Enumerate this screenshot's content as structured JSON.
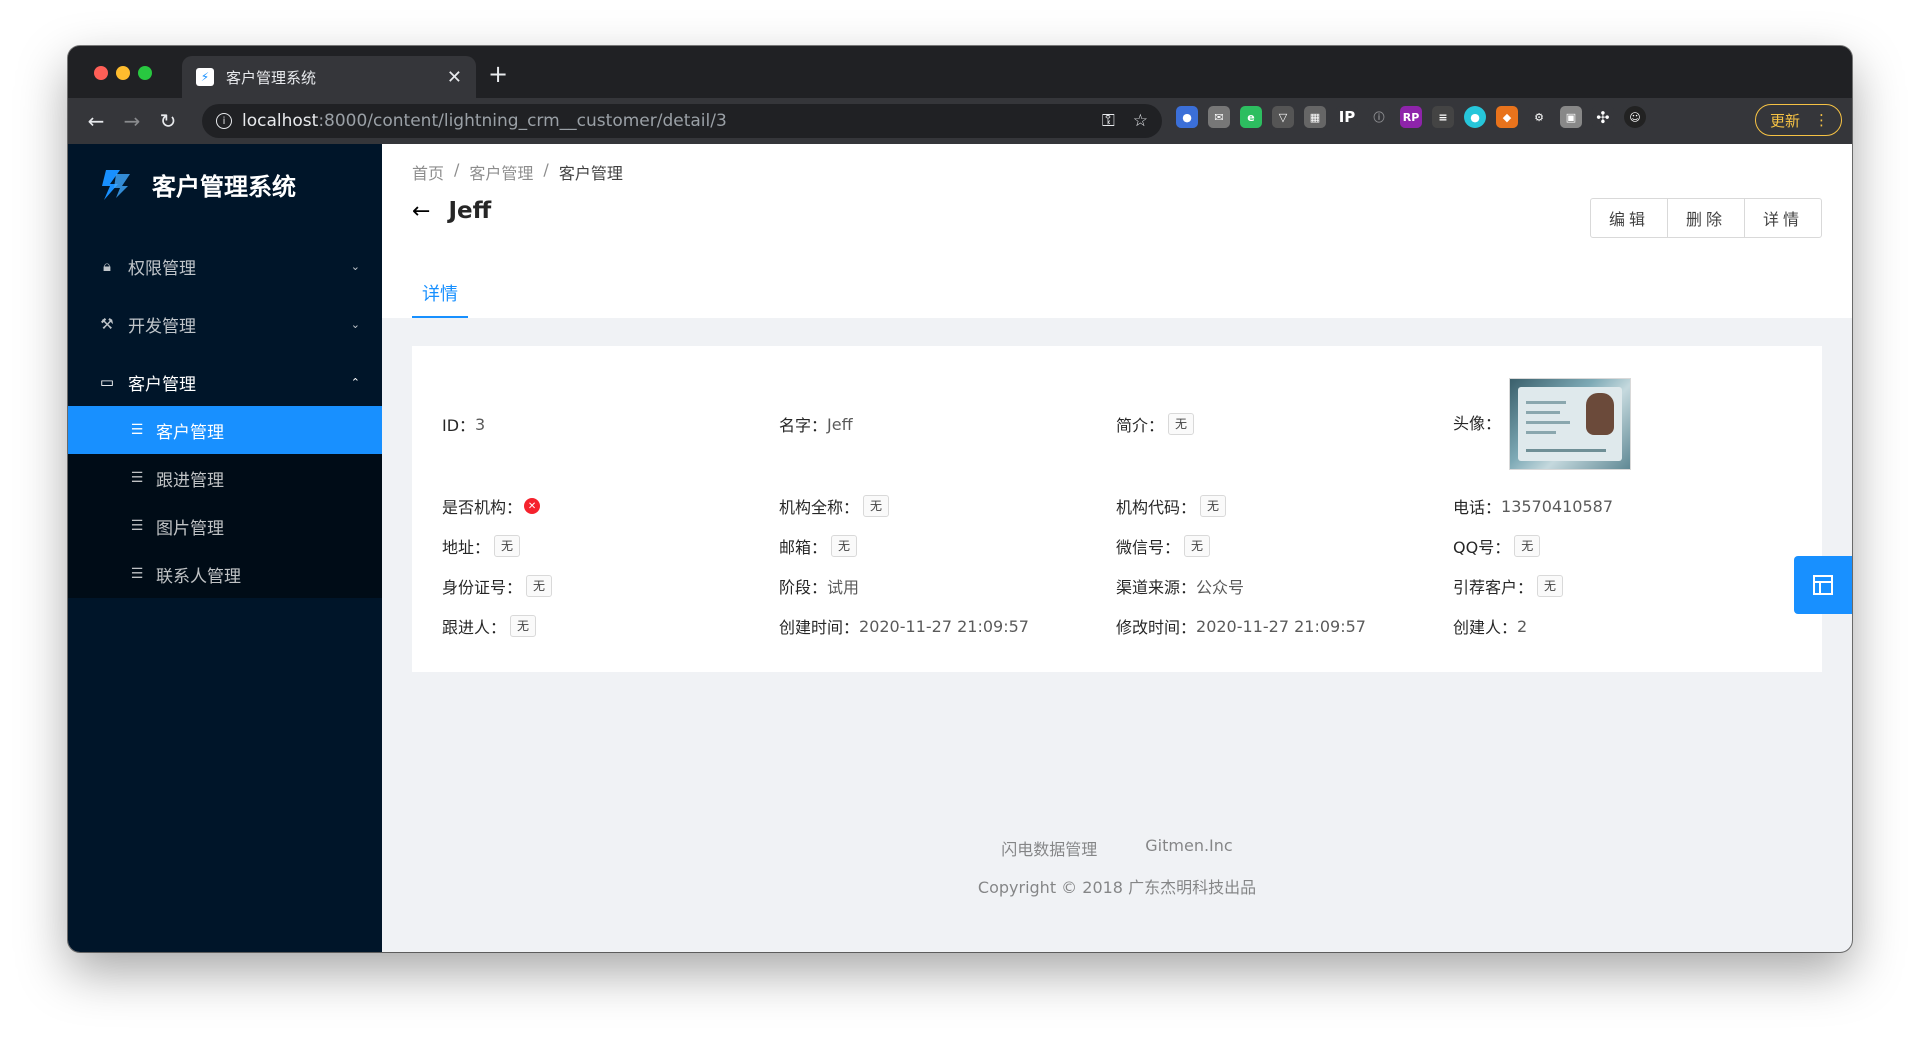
{
  "browser": {
    "tab_title": "客户管理系统",
    "url_host": "localhost",
    "url_rest": ":8000/content/lightning_crm__customer/detail/3",
    "update_label": "更新"
  },
  "sider": {
    "app_name": "客户管理系统",
    "menu": [
      {
        "label": "权限管理",
        "icon": "lock-icon"
      },
      {
        "label": "开发管理",
        "icon": "tool-icon"
      },
      {
        "label": "客户管理",
        "icon": "idcard-icon"
      }
    ],
    "submenu": [
      {
        "label": "客户管理"
      },
      {
        "label": "跟进管理"
      },
      {
        "label": "图片管理"
      },
      {
        "label": "联系人管理"
      }
    ]
  },
  "header": {
    "breadcrumb": [
      "首页",
      "/",
      "客户管理",
      "/",
      "客户管理"
    ],
    "title": "Jeff",
    "buttons": [
      "编辑",
      "删除",
      "详情"
    ],
    "tab": "详情"
  },
  "details": {
    "row1": [
      {
        "label": "ID：",
        "value": "3"
      },
      {
        "label": "名字：",
        "value": "Jeff"
      },
      {
        "label": "简介：",
        "tag": "无"
      },
      {
        "label": "头像："
      }
    ],
    "row2": [
      {
        "label": "是否机构："
      },
      {
        "label": "机构全称：",
        "tag": "无"
      },
      {
        "label": "机构代码：",
        "tag": "无"
      },
      {
        "label": "电话：",
        "value": "13570410587"
      }
    ],
    "row3": [
      {
        "label": "地址：",
        "tag": "无"
      },
      {
        "label": "邮箱：",
        "tag": "无"
      },
      {
        "label": "微信号：",
        "tag": "无"
      },
      {
        "label": "QQ号：",
        "tag": "无"
      }
    ],
    "row4": [
      {
        "label": "身份证号：",
        "tag": "无"
      },
      {
        "label": "阶段：",
        "value": "试用"
      },
      {
        "label": "渠道来源：",
        "value": "公众号"
      },
      {
        "label": "引荐客户：",
        "tag": "无"
      }
    ],
    "row5": [
      {
        "label": "跟进人：",
        "tag": "无"
      },
      {
        "label": "创建时间：",
        "value": "2020-11-27 21:09:57"
      },
      {
        "label": "修改时间：",
        "value": "2020-11-27 21:09:57"
      },
      {
        "label": "创建人：",
        "value": "2"
      }
    ]
  },
  "footer": {
    "links": [
      "闪电数据管理",
      "Gitmen.Inc"
    ],
    "copyright": "Copyright © 2018 广东杰明科技出品"
  },
  "colors": {
    "primary": "#1890ff",
    "sider_bg": "#001529",
    "error": "#f5222d"
  }
}
